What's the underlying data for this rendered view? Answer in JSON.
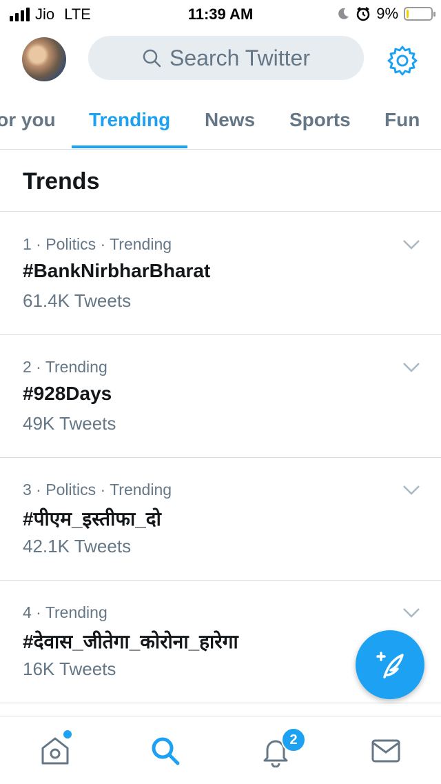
{
  "status_bar": {
    "carrier": "Jio",
    "network": "LTE",
    "time": "11:39 AM",
    "battery_percent": "9%",
    "battery_level": 0.09
  },
  "header": {
    "search_placeholder": "Search Twitter",
    "avatar_icon": "profile-avatar",
    "settings_icon": "gear-icon"
  },
  "tabs": [
    {
      "label": "For you",
      "active": false
    },
    {
      "label": "Trending",
      "active": true
    },
    {
      "label": "News",
      "active": false
    },
    {
      "label": "Sports",
      "active": false
    },
    {
      "label": "Fun",
      "active": false
    }
  ],
  "section_title": "Trends",
  "trends": [
    {
      "meta": "1 · Politics · Trending",
      "name": "#BankNirbharBharat",
      "count": "61.4K Tweets"
    },
    {
      "meta": "2 · Trending",
      "name": "#928Days",
      "count": "49K Tweets"
    },
    {
      "meta": "3 · Politics · Trending",
      "name": "#पीएम_इस्तीफा_दो",
      "count": "42.1K Tweets"
    },
    {
      "meta": "4 · Trending",
      "name": "#देवास_जीतेगा_कोरोना_हारेगा",
      "count": "16K Tweets"
    }
  ],
  "bottom_nav": {
    "notifications_badge": "2",
    "items": [
      "home-icon",
      "search-icon",
      "notifications-icon",
      "messages-icon"
    ]
  },
  "colors": {
    "accent": "#1da1f2",
    "text_primary": "#14171a",
    "text_secondary": "#657786",
    "divider": "#d8dde1"
  }
}
